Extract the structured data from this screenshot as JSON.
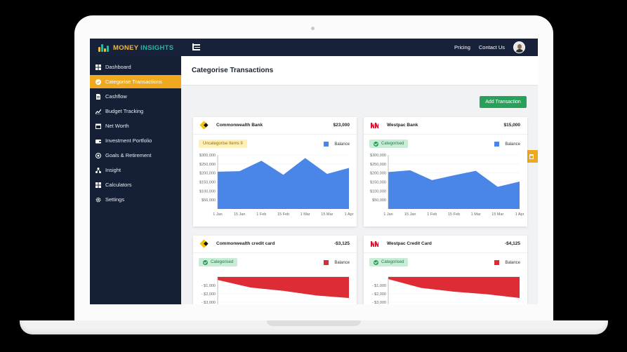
{
  "app": {
    "logo_part1": "MONEY",
    "logo_part2": "INSIGHTS"
  },
  "topnav": {
    "links": [
      "Pricing",
      "Contact Us"
    ]
  },
  "sidebar": {
    "items": [
      {
        "label": "Dashboard",
        "icon": "grid-icon"
      },
      {
        "label": "Categorise Transactions",
        "icon": "tag-icon",
        "active": true
      },
      {
        "label": "Cashflow",
        "icon": "document-icon"
      },
      {
        "label": "Budget Tracking",
        "icon": "trend-icon"
      },
      {
        "label": "Net Worth",
        "icon": "calendar-icon"
      },
      {
        "label": "Investment Portfolio",
        "icon": "wallet-icon"
      },
      {
        "label": "Goals & Retirement",
        "icon": "target-icon"
      },
      {
        "label": "Insight",
        "icon": "network-icon"
      },
      {
        "label": "Calculators",
        "icon": "calculator-icon"
      },
      {
        "label": "Settings",
        "icon": "gear-icon"
      }
    ]
  },
  "page": {
    "title": "Categorise Transactions",
    "add_button": "Add Transaction"
  },
  "colors": {
    "accent": "#f0a81f",
    "navy": "#17213a",
    "green": "#27a15a",
    "balance_blue": "#4a86e8",
    "balance_red": "#dd2c35"
  },
  "cards": [
    {
      "bank": "Commonwealth Bank",
      "amount": "$23,000",
      "badge": "Uncategorise Items 9",
      "legend": "Balance"
    },
    {
      "bank": "Westpac Bank",
      "amount": "$15,000",
      "badge": "Categorised",
      "legend": "Balance"
    },
    {
      "bank": "Commonwealth credit card",
      "amount": "-$3,125",
      "badge": "Categorised",
      "legend": "Balance"
    },
    {
      "bank": "Westpac Credit Card",
      "amount": "-$4,125",
      "badge": "Categorised",
      "legend": "Balance"
    }
  ],
  "chart_data": [
    {
      "type": "area",
      "legend": "Balance",
      "x": [
        "1 Jan",
        "15 Jan",
        "1 Feb",
        "15 Feb",
        "1 Mar",
        "15 Mar",
        "1 Apr"
      ],
      "x_positions": [
        0,
        1,
        2,
        3,
        4,
        5,
        6,
        7,
        8,
        9,
        10,
        11
      ],
      "y_ticks": [
        "$300,000",
        "$250,000",
        "$200,000",
        "$150,000",
        "$100,000",
        "$50,000"
      ],
      "ylim": [
        0,
        300000
      ],
      "values": [
        207000,
        210000,
        268000,
        190000,
        283000,
        195000,
        228000
      ]
    },
    {
      "type": "area",
      "legend": "Balance",
      "x": [
        "1 Jan",
        "15 Jan",
        "1 Feb",
        "15 Feb",
        "1 Mar",
        "15 Mar",
        "1 Apr"
      ],
      "y_ticks": [
        "$300,000",
        "$250,000",
        "$200,000",
        "$150,000",
        "$100,000",
        "$50,000"
      ],
      "ylim": [
        0,
        300000
      ],
      "values": [
        205000,
        215000,
        160000,
        187000,
        212000,
        123000,
        152000
      ]
    },
    {
      "type": "area",
      "legend": "Balance",
      "y_ticks": [
        "- $1,000",
        "- $2,000",
        "- $3,000"
      ],
      "values": [
        -350,
        -1250,
        -1650,
        -2200,
        -2500
      ]
    },
    {
      "type": "area",
      "legend": "Balance",
      "y_ticks": [
        "- $1,000",
        "- $2,000",
        "- $3,000"
      ],
      "values": [
        -250,
        -1300,
        -1750,
        -2050,
        -2500
      ]
    }
  ]
}
